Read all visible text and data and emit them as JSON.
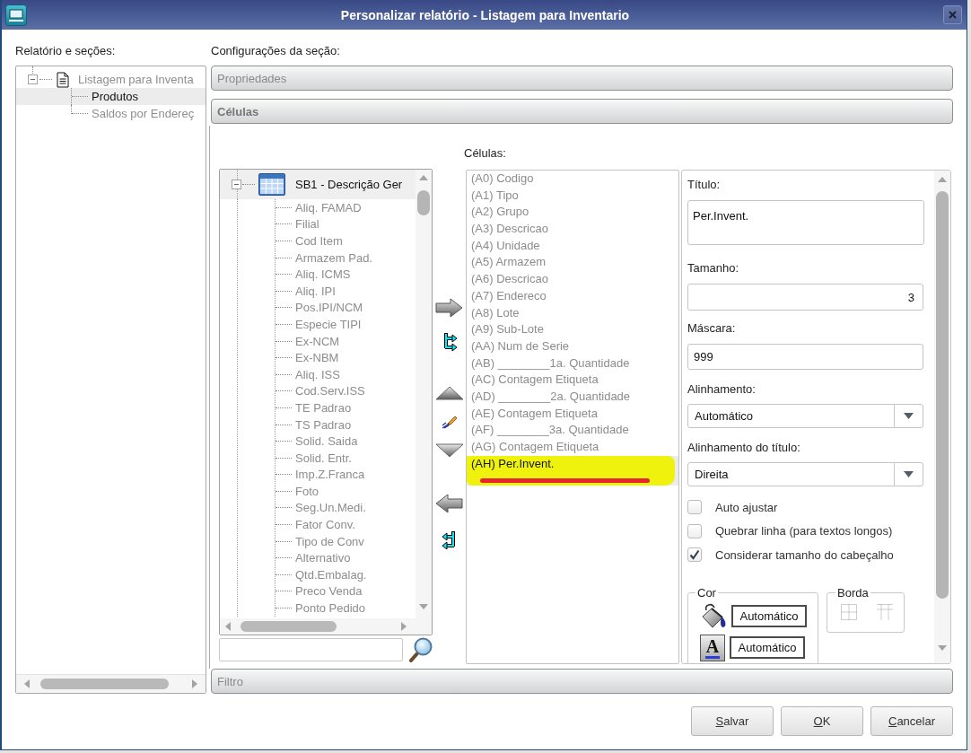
{
  "window": {
    "title": "Personalizar relatório - Listagem para Inventario"
  },
  "report_tree": {
    "label": "Relatório e seções:",
    "nodes": [
      {
        "label": "Listagem para Inventa",
        "expanded": true,
        "selected": false,
        "children": [
          {
            "label": "Produtos",
            "selected": true
          },
          {
            "label": "Saldos por Endereç",
            "selected": false
          }
        ]
      }
    ]
  },
  "sections": {
    "label": "Configurações da seção:",
    "items": [
      {
        "label": "Propriedades",
        "expanded": false
      },
      {
        "label": "Células",
        "expanded": true
      },
      {
        "label": "Filtro",
        "expanded": false
      }
    ]
  },
  "fields_tree": {
    "nodes": [
      {
        "label": "SB1 - Descrição Ger",
        "expanded": true,
        "selected": true,
        "children": [
          {
            "label": "Aliq. FAMAD",
            "selected": false
          },
          {
            "label": "Filial",
            "selected": false
          },
          {
            "label": "Cod Item",
            "selected": false
          },
          {
            "label": "Armazem Pad.",
            "selected": false
          },
          {
            "label": "Aliq. ICMS",
            "selected": false
          },
          {
            "label": "Aliq. IPI",
            "selected": false
          },
          {
            "label": "Pos.IPI/NCM",
            "selected": false
          },
          {
            "label": "Especie TIPI",
            "selected": false
          },
          {
            "label": "Ex-NCM",
            "selected": false
          },
          {
            "label": "Ex-NBM",
            "selected": false
          },
          {
            "label": "Aliq. ISS",
            "selected": false
          },
          {
            "label": "Cod.Serv.ISS",
            "selected": false
          },
          {
            "label": "TE Padrao",
            "selected": false
          },
          {
            "label": "TS Padrao",
            "selected": false
          },
          {
            "label": "Solid. Saida",
            "selected": false
          },
          {
            "label": "Solid. Entr.",
            "selected": false
          },
          {
            "label": "Imp.Z.Franca",
            "selected": false
          },
          {
            "label": "Foto",
            "selected": false
          },
          {
            "label": "Seg.Un.Medi.",
            "selected": false
          },
          {
            "label": "Fator Conv.",
            "selected": false
          },
          {
            "label": "Tipo de Conv",
            "selected": false
          },
          {
            "label": "Alternativo",
            "selected": false
          },
          {
            "label": "Qtd.Embalag.",
            "selected": false
          },
          {
            "label": "Preco Venda",
            "selected": false
          },
          {
            "label": "Ponto Pedido",
            "selected": false
          }
        ]
      }
    ]
  },
  "cells": {
    "label": "Células:",
    "items": [
      {
        "label": "(A0) Codigo",
        "selected": false,
        "highlighted": false
      },
      {
        "label": "(A1) Tipo",
        "selected": false,
        "highlighted": false
      },
      {
        "label": "(A2) Grupo",
        "selected": false,
        "highlighted": false
      },
      {
        "label": "(A3) Descricao",
        "selected": false,
        "highlighted": false
      },
      {
        "label": "(A4) Unidade",
        "selected": false,
        "highlighted": false
      },
      {
        "label": "(A5) Armazem",
        "selected": false,
        "highlighted": false
      },
      {
        "label": "(A6) Descricao",
        "selected": false,
        "highlighted": false
      },
      {
        "label": "(A7) Endereco",
        "selected": false,
        "highlighted": false
      },
      {
        "label": "(A8) Lote",
        "selected": false,
        "highlighted": false
      },
      {
        "label": "(A9) Sub-Lote",
        "selected": false,
        "highlighted": false
      },
      {
        "label": "(AA) Num de Serie",
        "selected": false,
        "highlighted": false
      },
      {
        "label": "(AB) ________1a. Quantidade",
        "selected": false,
        "highlighted": false
      },
      {
        "label": "(AC) Contagem Etiqueta",
        "selected": false,
        "highlighted": false
      },
      {
        "label": "(AD) ________2a. Quantidade",
        "selected": false,
        "highlighted": false
      },
      {
        "label": "(AE) Contagem Etiqueta",
        "selected": false,
        "highlighted": false
      },
      {
        "label": "(AF) ________3a. Quantidade",
        "selected": false,
        "highlighted": false
      },
      {
        "label": "(AG) Contagem Etiqueta",
        "selected": false,
        "highlighted": false
      },
      {
        "label": "(AH) Per.Invent.",
        "selected": true,
        "highlighted": true
      }
    ]
  },
  "properties": {
    "fields": [
      {
        "kind": "textarea",
        "label": "Título:",
        "value": "Per.Invent."
      },
      {
        "kind": "number",
        "label": "Tamanho:",
        "value": "3"
      },
      {
        "kind": "text",
        "label": "Máscara:",
        "value": "999"
      },
      {
        "kind": "select",
        "label": "Alinhamento:",
        "value": "Automático"
      },
      {
        "kind": "select",
        "label": "Alinhamento do título:",
        "value": "Direita"
      }
    ],
    "checkboxes": [
      {
        "label": "Auto ajustar",
        "checked": false
      },
      {
        "label": "Quebrar linha (para textos longos)",
        "checked": false
      },
      {
        "label": "Considerar tamanho do cabeçalho",
        "checked": true
      }
    ],
    "color_group": {
      "label": "Cor",
      "fill_value": "Automático",
      "text_glyph": "A",
      "text_value": "Automático"
    },
    "border_group": {
      "label": "Borda"
    }
  },
  "buttons": [
    {
      "label": "Salvar"
    },
    {
      "label": "OK"
    },
    {
      "label": "Cancelar"
    }
  ]
}
